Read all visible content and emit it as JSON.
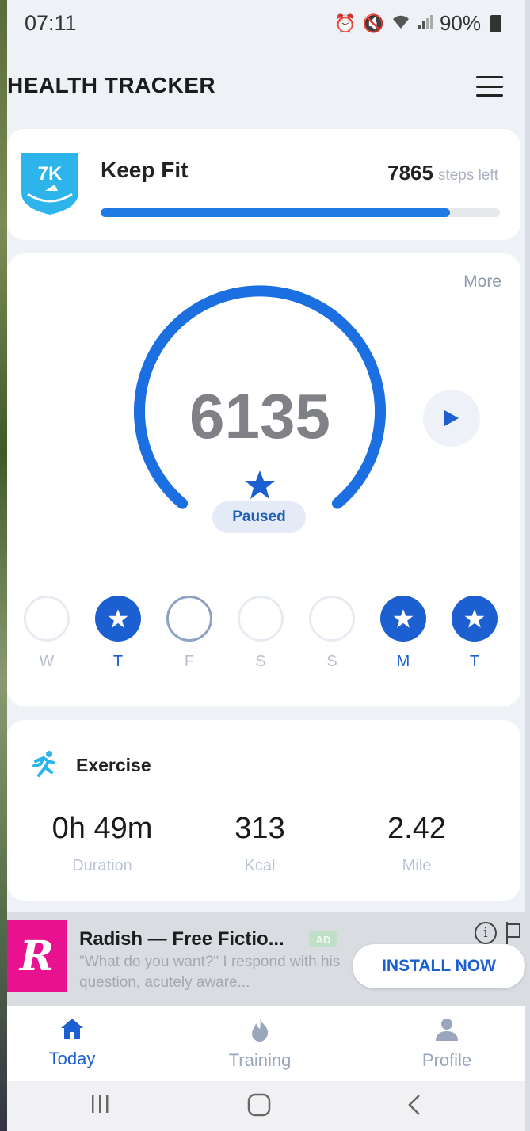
{
  "status_bar": {
    "time": "07:11",
    "battery": "90%"
  },
  "header": {
    "title": "HEALTH TRACKER",
    "menu_icon": "hamburger-menu-icon"
  },
  "goal": {
    "badge_text": "7K",
    "title": "Keep Fit",
    "steps_left": "7865",
    "steps_left_label": "steps left",
    "progress": 0.875,
    "accent": "#1e7be6"
  },
  "main": {
    "more": "More",
    "steps": "6135",
    "status": "Paused",
    "gauge_color": "#1b6fe0"
  },
  "week": [
    {
      "label": "W",
      "state": "empty"
    },
    {
      "label": "T",
      "state": "done"
    },
    {
      "label": "F",
      "state": "today"
    },
    {
      "label": "S",
      "state": "empty"
    },
    {
      "label": "S",
      "state": "empty"
    },
    {
      "label": "M",
      "state": "done"
    },
    {
      "label": "T",
      "state": "done"
    }
  ],
  "exercise": {
    "title": "Exercise",
    "stats": [
      {
        "value": "0h 49m",
        "label": "Duration"
      },
      {
        "value": "313",
        "label": "Kcal"
      },
      {
        "value": "2.42",
        "label": "Mile"
      }
    ]
  },
  "ad": {
    "logo_letter": "R",
    "title": "Radish — Free Fictio...",
    "tag": "AD",
    "description": "\"What do you want?\" I respond with his question, acutely aware...",
    "cta": "INSTALL NOW",
    "brand_color": "#e8118f"
  },
  "bottom_nav": {
    "items": [
      {
        "label": "Today",
        "icon": "home-icon",
        "active": true
      },
      {
        "label": "Training",
        "icon": "flame-icon",
        "active": false
      },
      {
        "label": "Profile",
        "icon": "person-icon",
        "active": false
      }
    ]
  }
}
